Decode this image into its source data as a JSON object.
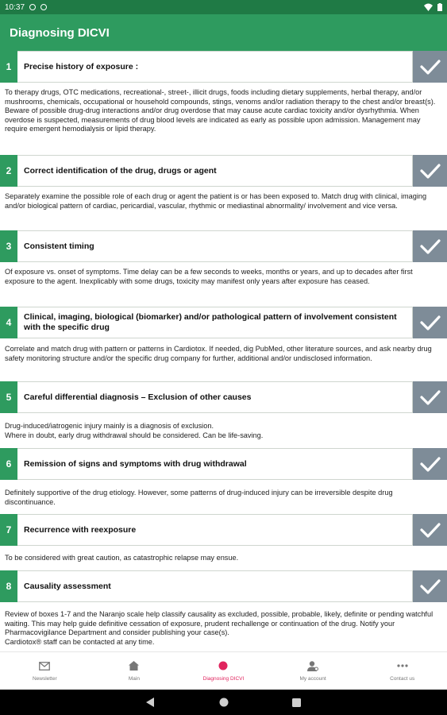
{
  "status_bar": {
    "time": "10:37"
  },
  "app_bar": {
    "title": "Diagnosing DICVI"
  },
  "steps": [
    {
      "number": "1",
      "title": "Precise history of exposure :",
      "description": "To therapy drugs, OTC medications, recreational-, street-, illicit drugs, foods including dietary supplements, herbal therapy, and/or mushrooms, chemicals, occupational or household compounds, stings, venoms and/or radiation therapy to the chest and/or breast(s).\nBeware of possible drug-drug interactions and/or drug overdose that may cause acute cardiac toxicity and/or dysrhythmia. When overdose is suspected, measurements of drug blood levels are indicated as early as possible upon admission. Management may require emergent hemodialysis or lipid therapy."
    },
    {
      "number": "2",
      "title": "Correct identification of the drug, drugs or agent",
      "description": "Separately examine the possible role of each drug or agent the patient is or has been exposed to. Match drug with clinical, imaging and/or biological pattern of cardiac, pericardial, vascular, rhythmic or mediastinal abnormality/ involvement and vice versa."
    },
    {
      "number": "3",
      "title": "Consistent timing",
      "description": "Of exposure vs. onset of symptoms. Time delay can be a few seconds to weeks, months or years, and up to decades after first exposure to the agent. Inexplicably with some drugs, toxicity may manifest only years after exposure has ceased."
    },
    {
      "number": "4",
      "title": "Clinical, imaging, biological (biomarker) and/or pathological pattern of involvement consistent with the specific drug",
      "description": "Correlate and match drug with pattern or patterns in Cardiotox. If needed, dig PubMed, other literature sources, and ask nearby drug safety monitoring structure and/or the specific drug company for further, additional and/or undisclosed information."
    },
    {
      "number": "5",
      "title": "Careful differential diagnosis – Exclusion of other causes",
      "description": "Drug-induced/iatrogenic injury mainly is a diagnosis of exclusion.\nWhere in doubt, early drug withdrawal should be considered. Can be life-saving."
    },
    {
      "number": "6",
      "title": "Remission of signs and symptoms with drug withdrawal",
      "description": "Definitely supportive of the drug etiology. However, some patterns of drug-induced injury can be irreversible despite drug discontinuance."
    },
    {
      "number": "7",
      "title": "Recurrence with reexposure",
      "description": "To be considered with great caution, as catastrophic relapse may ensue."
    },
    {
      "number": "8",
      "title": "Causality assessment",
      "description": "Review of boxes 1-7 and the Naranjo scale help classify causality as excluded, possible, probable, likely, definite or pending watchful waiting. This may help guide definitive cessation of exposure, prudent rechallenge or continuation of the drug. Notify your Pharmacovigilance Department and consider publishing your case(s).\nCardiotox® staff can be contacted at any time."
    }
  ],
  "bottom_nav": [
    {
      "label": "Newsletter",
      "icon": "mail-icon"
    },
    {
      "label": "Main",
      "icon": "home-icon"
    },
    {
      "label": "Diagnosing DICVI",
      "icon": "dot-icon"
    },
    {
      "label": "My account",
      "icon": "account-icon"
    },
    {
      "label": "Contact us",
      "icon": "more-icon"
    }
  ],
  "colors": {
    "status_bar": "#1f7a45",
    "app_bar": "#2e9b5f",
    "check_box": "#7e8c98",
    "active_nav": "#e0245e"
  }
}
